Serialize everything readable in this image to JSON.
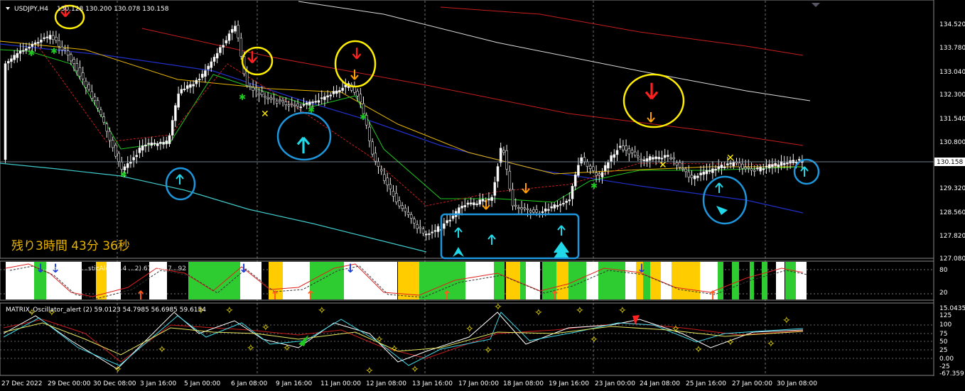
{
  "header": {
    "symbol": "USDJPY,H4",
    "quote": "130.128 130.200 130.078 130.158"
  },
  "timer_text": "残り3時間 43分 36秒",
  "current_price_label": "130.158",
  "main_panel": {
    "price_ticks": [
      "134.520",
      "133.780",
      "133.040",
      "132.300",
      "131.540",
      "130.800",
      "129.320",
      "128.560",
      "127.820",
      "127.080"
    ]
  },
  "panel2": {
    "label": "...no (2) 1... ...sticAlert... 4 ...2) 67...00 7...92",
    "levels": [
      "80",
      "20"
    ]
  },
  "panel3": {
    "label": "MATRIX_Oscillator_alert (2) 59.0123 54.7985 56.6985 59.6154",
    "top_value": "15.0435",
    "levels": [
      "125",
      "100",
      "75",
      "50",
      "25",
      "0.00",
      "-25",
      "-67.359"
    ]
  },
  "time_axis": [
    "27 Dec 2022",
    "29 Dec 00:00",
    "30 Dec 08:00",
    "3 Jan 16:00",
    "5 Jan 00:00",
    "6 Jan 08:00",
    "9 Jan 16:00",
    "11 Jan 00:00",
    "12 Jan 08:00",
    "13 Jan 16:00",
    "17 Jan 00:00",
    "18 Jan 08:00",
    "19 Jan 16:00",
    "23 Jan 00:00",
    "24 Jan 08:00",
    "25 Jan 16:00",
    "27 Jan 00:00",
    "30 Jan 08:00"
  ],
  "colors": {
    "background": "#000000",
    "grid": "#c8c8c8",
    "bull_candle": "#ffffff",
    "bear_candle": "#f5f5dc",
    "ma_fast": "#1ec81e",
    "ma_yellow": "#e6b400",
    "ma_blue": "#2030c8",
    "ma_red": "#c81e1e",
    "ma_white": "#dcdcdc",
    "band_cyan": "#40c8c8",
    "annotation_yellow": "#ffee00",
    "annotation_blue": "#1e96dc",
    "arrow_cyan": "#20d8e8",
    "arrow_orange": "#ffa000",
    "arrow_red": "#ff2020",
    "histo_green": "#2ecc30",
    "histo_yellow": "#ffcc00",
    "histo_white": "#ffffff"
  }
}
